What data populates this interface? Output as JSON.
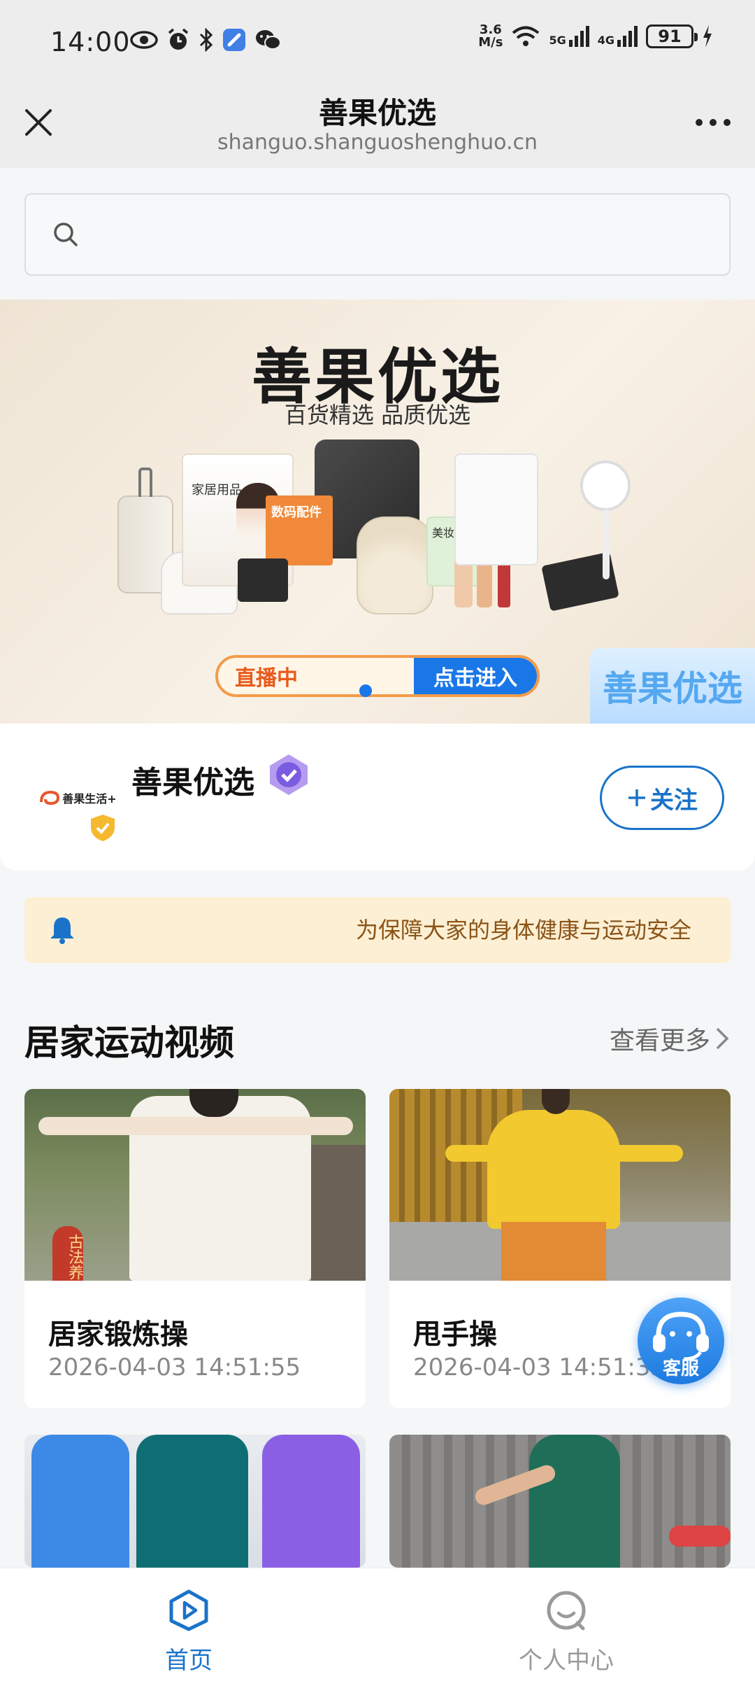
{
  "status_bar": {
    "time": "14:00",
    "speed_value": "3.6",
    "speed_unit": "M/s",
    "net1": "5G",
    "net2": "4G",
    "battery": "91"
  },
  "header": {
    "title": "善果优选",
    "url": "shanguo.shanguoshenghuo.cn"
  },
  "search": {
    "placeholder": ""
  },
  "banner": {
    "title": "善果优选",
    "subtitle": "百货精选 品质优选",
    "product_labels": [
      "家居用品",
      "数码配件",
      "美妆护护"
    ],
    "live_label": "直播中",
    "enter_label": "点击进入",
    "badge": "善果优选"
  },
  "shop": {
    "logo_text": "善果生活+",
    "name": "善果优选",
    "follow_label": "关注"
  },
  "notice": {
    "text": "为保障大家的身体健康与运动安全"
  },
  "section": {
    "title": "居家运动视频",
    "more_label": "查看更多"
  },
  "videos": [
    {
      "title": "居家锻炼操",
      "date": "2026-04-03 14:51:55",
      "tag": "古法养"
    },
    {
      "title": "甩手操",
      "date": "2026-04-03 14:51:33"
    }
  ],
  "customer_service": {
    "label": "客服"
  },
  "bottom_nav": [
    {
      "label": "首页",
      "active": true
    },
    {
      "label": "个人中心",
      "active": false
    }
  ],
  "colors": {
    "accent": "#1a73c9",
    "notice_bg": "#fdefd3",
    "notice_text": "#8a5418"
  }
}
